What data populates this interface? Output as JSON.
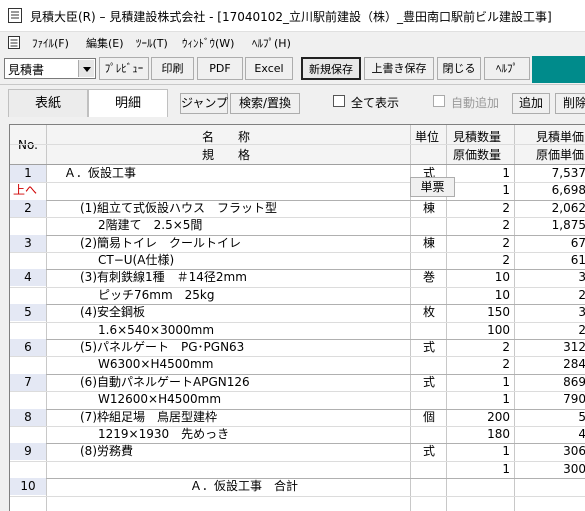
{
  "window": {
    "title": "見積大臣(R) – 見積建設株式会社 - [17040102_立川駅前建設（株）_豊田南口駅前ビル建設工事]"
  },
  "menu": [
    "ﾌｧｲﾙ(F)",
    "編集(E)",
    "ﾂｰﾙ(T)",
    "ｳｨﾝﾄﾞｳ(W)",
    "ﾍﾙﾌﾟ(H)"
  ],
  "toolbar": {
    "combo_value": "見積書",
    "buttons": [
      "ﾌﾟﾚﾋﾞｭｰ",
      "印刷",
      "PDF",
      "Excel",
      "新規保存",
      "上書き保存",
      "閉じる",
      "ﾍﾙﾌﾟ"
    ]
  },
  "tabs": [
    "表紙",
    "明細"
  ],
  "subbar": {
    "jump": "ジャンプ",
    "search": "検索/置換",
    "show_all": "全て表示",
    "auto_add": "自動追加",
    "add": "追加",
    "delete": "削除"
  },
  "grid": {
    "headers": {
      "no": "No.",
      "name": "名　　称",
      "spec": "規　　格",
      "unit": "単位",
      "qty": "見積数量",
      "cost_qty": "原価数量",
      "price": "見積単価",
      "cost_price": "原価単価"
    },
    "up_label": "上へ",
    "tanpyo_label": "単票",
    "rows": [
      {
        "no": "1",
        "name": "Ａ．仮設工事",
        "spec": "",
        "unit": "式",
        "qty": "1",
        "cost_qty": "1",
        "price": "7,537",
        "cost_price": "6,698"
      },
      {
        "no": "2",
        "name": "(1)組立て式仮設ハウス　フラット型",
        "spec": "2階建て　2.5×5間",
        "unit": "棟",
        "qty": "2",
        "cost_qty": "2",
        "price": "2,062",
        "cost_price": "1,875"
      },
      {
        "no": "3",
        "name": "(2)簡易トイレ　クールトイレ",
        "spec": "CT−U(A仕様)",
        "unit": "棟",
        "qty": "2",
        "cost_qty": "2",
        "price": "67",
        "cost_price": "61"
      },
      {
        "no": "4",
        "name": "(3)有刺鉄線1種　＃14径2mm",
        "spec": "ピッチ76mm　25kg",
        "unit": "巻",
        "qty": "10",
        "cost_qty": "10",
        "price": "3",
        "cost_price": "2"
      },
      {
        "no": "5",
        "name": "(4)安全鋼板",
        "spec": "1.6×540×3000mm",
        "unit": "枚",
        "qty": "150",
        "cost_qty": "100",
        "price": "3",
        "cost_price": "2"
      },
      {
        "no": "6",
        "name": "(5)パネルゲート　PG･PGN63",
        "spec": "W6300×H4500mm",
        "unit": "式",
        "qty": "2",
        "cost_qty": "2",
        "price": "312",
        "cost_price": "284"
      },
      {
        "no": "7",
        "name": "(6)自動パネルゲートAPGN126",
        "spec": "W12600×H4500mm",
        "unit": "式",
        "qty": "1",
        "cost_qty": "1",
        "price": "869",
        "cost_price": "790"
      },
      {
        "no": "8",
        "name": "(7)枠組足場　鳥居型建枠",
        "spec": "1219×1930　先めっき",
        "unit": "個",
        "qty": "200",
        "cost_qty": "180",
        "price": "5",
        "cost_price": "4"
      },
      {
        "no": "9",
        "name": "(8)労務費",
        "spec": "",
        "unit": "式",
        "qty": "1",
        "cost_qty": "1",
        "price": "306",
        "cost_price": "300"
      },
      {
        "no": "10",
        "name": "Ａ．仮設工事　合計",
        "spec": "",
        "unit": "",
        "qty": "",
        "cost_qty": "",
        "price": "",
        "cost_price": ""
      }
    ]
  }
}
